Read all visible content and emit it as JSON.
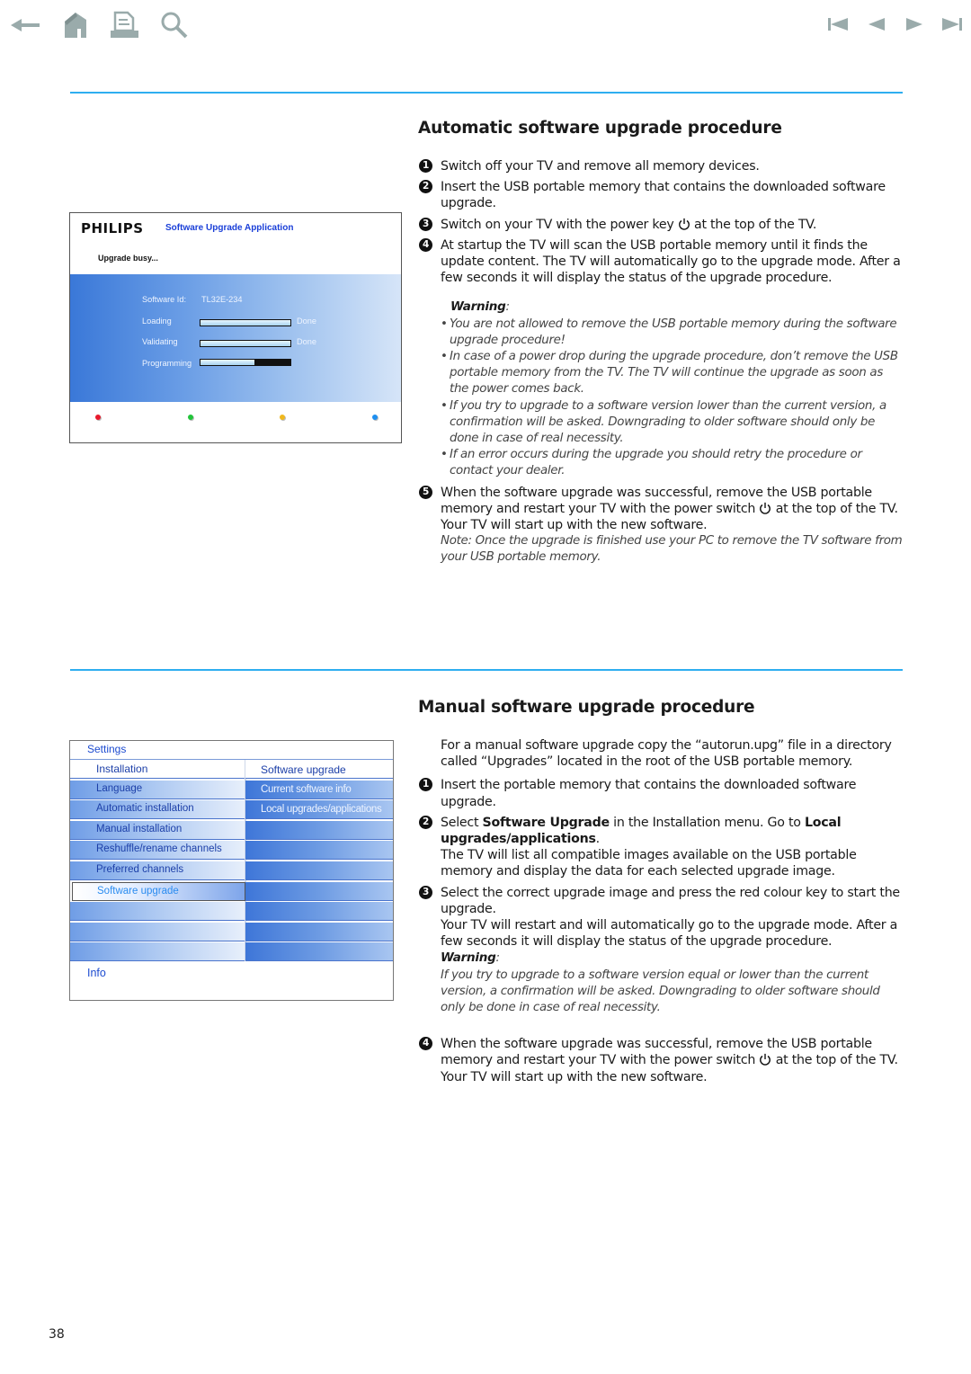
{
  "nav": {
    "left_icons": [
      "back-arrow-icon",
      "home-icon",
      "print-icon",
      "search-icon"
    ],
    "right_icons": [
      "first-page-icon",
      "previous-page-icon",
      "next-page-icon",
      "last-page-icon"
    ],
    "icon_color": "#9aabab"
  },
  "accent_color": "#2eaef0",
  "automatic": {
    "title": "Automatic software upgrade procedure",
    "steps": [
      {
        "num": "1",
        "text": "Switch off your TV and remove all memory devices."
      },
      {
        "num": "2",
        "text": "Insert the USB portable memory that contains the downloaded software upgrade."
      },
      {
        "num": "3",
        "text_before": "Switch on your TV with the power key",
        "text_after": "at the top of the TV."
      },
      {
        "num": "4",
        "text": "At startup the TV will scan the USB portable memory until it finds the update content. The TV will automatically go to the upgrade mode. After a few seconds it will display the status of the upgrade procedure."
      }
    ],
    "warning_label": "Warning",
    "warnings": [
      "You are not allowed to remove the USB portable memory during the software upgrade procedure!",
      "In case of a power drop during the upgrade procedure, don’t remove the USB portable memory from the TV. The TV will continue the upgrade as soon as the power comes back.",
      "If you try to upgrade to a software version lower than the current version, a confirmation will be asked. Downgrading to older software should only be done in case of real necessity.",
      "If an error occurs during the upgrade you should retry the procedure or contact your dealer."
    ],
    "step5": {
      "num": "5",
      "text_before": "When the software upgrade was successful, remove the USB portable memory and restart your TV with the power switch",
      "text_after": "at the top of the TV.",
      "line2": "Your TV will start up with the new software.",
      "note": "Note: Once the upgrade is finished use your PC to remove the TV software from your USB portable memory."
    }
  },
  "tv_upgrade_screen": {
    "brand": "PHILIPS",
    "app_title": "Software Upgrade Application",
    "status": "Upgrade busy...",
    "software_id_label": "Software Id:",
    "software_id": "TL32E-234",
    "progress": [
      {
        "label": "Loading",
        "percent": 100,
        "state": "Done"
      },
      {
        "label": "Validating",
        "percent": 100,
        "state": "Done"
      },
      {
        "label": "Programming",
        "percent": 60,
        "state": ""
      }
    ],
    "color_keys": [
      "#e8192c",
      "#22c43a",
      "#f0b81e",
      "#1e8ff0"
    ]
  },
  "manual": {
    "title": "Manual software upgrade procedure",
    "intro": "For a manual software upgrade copy the “autorun.upg” file in a directory called “Upgrades” located in the root of the USB portable memory.",
    "step1": {
      "num": "1",
      "text": "Insert the portable memory that contains the downloaded software upgrade."
    },
    "step2": {
      "num": "2",
      "pre": "Select ",
      "bold1": "Software Upgrade",
      "mid": " in the Installation menu. Go to ",
      "bold2": "Local upgrades/applications",
      "post": ".",
      "line2": "The TV will list all compatible images available on the USB portable memory and display the data for each selected upgrade image."
    },
    "step3": {
      "num": "3",
      "text": "Select the correct upgrade image and press the red colour key to start the upgrade.",
      "line2": "Your TV will restart and will automatically go to the upgrade mode. After a few seconds it will display the status of the upgrade procedure.",
      "warning_label": "Warning",
      "warning": "If you try to upgrade to a software version equal or lower than the current version, a confirmation will be asked. Downgrading to older software should only be done in case of real necessity."
    },
    "step4": {
      "num": "4",
      "text_before": "When the software upgrade was successful, remove the USB portable memory and restart your TV with the power switch",
      "text_after": "at the top of the TV. Your TV will start up with the new software."
    }
  },
  "tv_menu": {
    "header": "Settings",
    "left_items": [
      "Installation",
      "Language",
      "Automatic installation",
      "Manual installation",
      "Reshuffle/rename channels",
      "Preferred channels",
      "Software upgrade",
      "",
      "",
      ""
    ],
    "selected_left": "Software upgrade",
    "right_items": [
      "Software upgrade",
      "Current software info",
      "Local upgrades/applications",
      "",
      "",
      "",
      "",
      "",
      "",
      ""
    ],
    "footer": "Info"
  },
  "page_number": "38"
}
